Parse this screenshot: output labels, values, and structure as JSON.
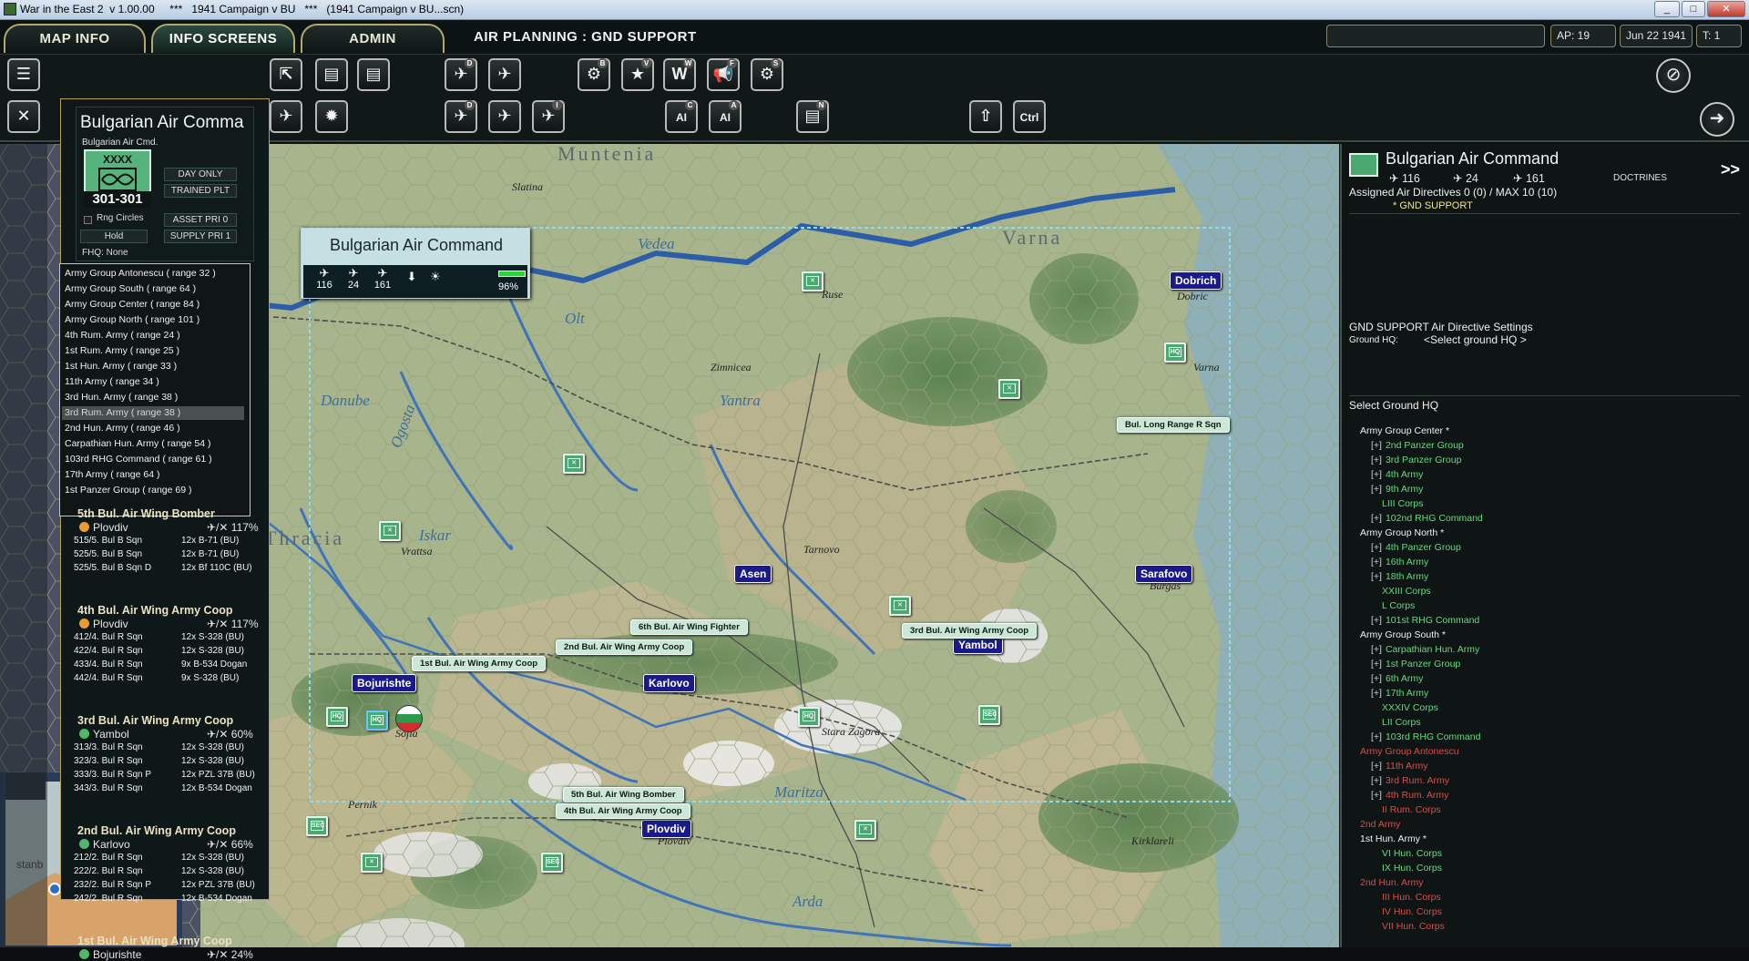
{
  "window": {
    "title": "War in the East 2  v 1.00.00     ***   1941 Campaign v BU   ***   (1941 Campaign v BU...scn)",
    "minimize": "_",
    "maximize": "□",
    "close": "✕"
  },
  "menu": {
    "tabs": [
      "MAP INFO",
      "INFO SCREENS",
      "ADMIN"
    ],
    "active": "INFO SCREENS",
    "screen_title": "AIR PLANNING : GND SUPPORT"
  },
  "status": {
    "ap": "AP: 19",
    "date": "Jun 22 1941",
    "turn": "T: 1"
  },
  "toolbar": {
    "row1": [
      {
        "icon": "unit-reaction-icon",
        "glyph": "⇱",
        "key": ""
      },
      {
        "icon": "orders-icon",
        "glyph": "▤",
        "key": ""
      },
      {
        "icon": "orders2-icon",
        "glyph": "▤",
        "key": ""
      },
      {
        "icon": "air-transfer-icon",
        "glyph": "✈",
        "key": "D"
      },
      {
        "icon": "air-move-icon",
        "glyph": "✈",
        "key": ""
      },
      {
        "icon": "theater-icon",
        "glyph": "⚙",
        "key": "B"
      },
      {
        "icon": "star-icon",
        "glyph": "★",
        "key": "V"
      },
      {
        "icon": "weather-icon",
        "glyph": "W",
        "key": "W"
      },
      {
        "icon": "announce-icon",
        "glyph": "📢",
        "key": "F"
      },
      {
        "icon": "settings-icon",
        "glyph": "⚙",
        "key": "S"
      }
    ],
    "row2": [
      {
        "icon": "air-mission-icon",
        "glyph": "✈",
        "key": "D"
      },
      {
        "icon": "air-mission2-icon",
        "glyph": "✈",
        "key": ""
      },
      {
        "icon": "air-strike-icon",
        "glyph": "✈",
        "key": "I"
      },
      {
        "icon": "ai-map-icon",
        "glyph": "AI",
        "key": "C"
      },
      {
        "icon": "ai-air-icon",
        "glyph": "AI",
        "key": "A"
      },
      {
        "icon": "air-list-icon",
        "glyph": "▤",
        "key": "N"
      },
      {
        "icon": "shift-icon",
        "glyph": "⇧",
        "key": ""
      },
      {
        "icon": "ctrl-icon",
        "glyph": "Ctrl",
        "key": ""
      }
    ]
  },
  "left_panel": {
    "hq": {
      "title": "Bulgarian Air Comma",
      "subtitle": "Bulgarian Air Cmd.",
      "echelon": "XXXX",
      "id": "301-301",
      "day_only": "DAY ONLY",
      "trained": "TRAINED PLT",
      "rng_circles": "Rng Circles",
      "asset_pri": "ASSET PRI 0",
      "hold": "Hold",
      "supply_pri": "SUPPLY PRI 1",
      "fhq": "FHQ: None"
    },
    "ground_list": [
      "Army Group Antonescu ( range 32 )",
      "Army Group South ( range 64 )",
      "Army Group Center ( range 84 )",
      "Army Group North ( range 101 )",
      "4th Rum. Army ( range 24 )",
      "1st Rum. Army ( range 25 )",
      "1st Hun. Army ( range 33 )",
      "11th Army ( range 34 )",
      "3rd Hun. Army ( range 38 )",
      "3rd Rum. Army ( range 38 )",
      "2nd Hun. Army ( range 46 )",
      "Carpathian Hun. Army ( range 54 )",
      "103rd RHG Command ( range 61 )",
      "17th Army ( range 64 )",
      "1st Panzer Group ( range 69 )"
    ],
    "ground_list_selected": 9,
    "wings": [
      {
        "title": "5th Bul. Air Wing Bomber",
        "base": "Plovdiv",
        "pct": "117%",
        "dot": "orange",
        "squadrons": [
          [
            "515/5. Bul B Sqn",
            "12x B-71 (BU)"
          ],
          [
            "525/5. Bul B Sqn",
            "12x B-71 (BU)"
          ],
          [
            "525/5. Bul B Sqn D",
            "12x Bf 110C (BU)"
          ]
        ]
      },
      {
        "title": "4th Bul. Air Wing Army Coop",
        "base": "Plovdiv",
        "pct": "117%",
        "dot": "orange",
        "squadrons": [
          [
            "412/4. Bul R Sqn",
            "12x S-328 (BU)"
          ],
          [
            "422/4. Bul R Sqn",
            "12x S-328 (BU)"
          ],
          [
            "433/4. Bul R Sqn",
            "9x B-534 Dogan"
          ],
          [
            "442/4. Bul R Sqn",
            "9x S-328 (BU)"
          ]
        ]
      },
      {
        "title": "3rd Bul. Air Wing Army Coop",
        "base": "Yambol",
        "pct": "60%",
        "dot": "green",
        "squadrons": [
          [
            "313/3. Bul R Sqn",
            "12x S-328 (BU)"
          ],
          [
            "323/3. Bul R Sqn",
            "12x S-328 (BU)"
          ],
          [
            "333/3. Bul R Sqn P",
            "12x PZL 37B (BU)"
          ],
          [
            "343/3. Bul R Sqn",
            "12x B-534 Dogan"
          ]
        ]
      },
      {
        "title": "2nd Bul. Air Wing Army Coop",
        "base": "Karlovo",
        "pct": "66%",
        "dot": "green",
        "squadrons": [
          [
            "212/2. Bul R Sqn",
            "12x S-328 (BU)"
          ],
          [
            "222/2. Bul R Sqn",
            "12x S-328 (BU)"
          ],
          [
            "232/2. Bul R Sqn P",
            "12x PZL 37B (BU)"
          ],
          [
            "242/2. Bul R Sqn",
            "12x B-534 Dogan"
          ]
        ]
      },
      {
        "title": "1st Bul. Air Wing Army Coop",
        "base": "Bojurishte",
        "pct": "24%",
        "dot": "green",
        "squadrons": []
      }
    ]
  },
  "map": {
    "airbox": {
      "name": "Bulgarian Air Command",
      "fighters": "116",
      "bombers": "24",
      "recon": "161",
      "morale": "96%"
    },
    "regions": [
      "Muntenia",
      "Varna",
      "Thracia"
    ],
    "rivers": [
      "Vedea",
      "Olt",
      "Danube",
      "Ogosta",
      "Iskar",
      "Yantra",
      "Maritza",
      "Arda"
    ],
    "towns": [
      "Slatina",
      "Ruse",
      "Zimnicea",
      "Dobric",
      "Varna",
      "Vrattsa",
      "Tarnovo",
      "Burgas",
      "Stara Zagora",
      "Pernik",
      "Plovdiv",
      "Kirklareli",
      "Sofia"
    ],
    "cities": [
      "Dobrich",
      "Asen",
      "Sarafovo",
      "Yambol",
      "Bojurishte",
      "Karlovo",
      "Plovdiv"
    ],
    "air_units": [
      "Bul. Long Range R Sqn",
      "6th Bul. Air Wing Fighter",
      "2nd Bul. Air Wing Army Coop",
      "1st Bul. Air Wing Army Coop",
      "3rd Bul. Air Wing Army Coop",
      "5th Bul. Air Wing Bomber",
      "4th Bul. Air Wing Army Coop"
    ],
    "minimap_label": "stanb"
  },
  "right_panel": {
    "title": "Bulgarian Air Command",
    "fighters": "116",
    "bombers": "24",
    "recon": "161",
    "doctrines": "DOCTRINES",
    "more": ">>",
    "assigned": "Assigned Air Directives 0 (0) / MAX 10 (10)",
    "directive": "* GND SUPPORT",
    "settings_title": "GND SUPPORT Air Directive Settings",
    "ground_hq_label": "Ground HQ:",
    "ground_hq_value": "<Select ground HQ >",
    "select_title": "Select Ground HQ",
    "tree": [
      {
        "indent": 0,
        "pm": "",
        "text": "Army Group Center *",
        "color": "w"
      },
      {
        "indent": 1,
        "pm": "[+]",
        "text": "2nd Panzer Group",
        "color": "g"
      },
      {
        "indent": 1,
        "pm": "[+]",
        "text": "3rd Panzer Group",
        "color": "g"
      },
      {
        "indent": 1,
        "pm": "[+]",
        "text": "4th Army",
        "color": "g"
      },
      {
        "indent": 1,
        "pm": "[+]",
        "text": "9th Army",
        "color": "g"
      },
      {
        "indent": 2,
        "pm": "",
        "text": "LIII Corps",
        "color": "g"
      },
      {
        "indent": 1,
        "pm": "[+]",
        "text": "102nd RHG Command",
        "color": "g"
      },
      {
        "indent": 0,
        "pm": "",
        "text": "Army Group North *",
        "color": "w"
      },
      {
        "indent": 1,
        "pm": "[+]",
        "text": "4th Panzer Group",
        "color": "g"
      },
      {
        "indent": 1,
        "pm": "[+]",
        "text": "16th Army",
        "color": "g"
      },
      {
        "indent": 1,
        "pm": "[+]",
        "text": "18th Army",
        "color": "g"
      },
      {
        "indent": 2,
        "pm": "",
        "text": "XXIII Corps",
        "color": "g"
      },
      {
        "indent": 2,
        "pm": "",
        "text": "L Corps",
        "color": "g"
      },
      {
        "indent": 1,
        "pm": "[+]",
        "text": "101st RHG Command",
        "color": "g"
      },
      {
        "indent": 0,
        "pm": "",
        "text": "Army Group South *",
        "color": "w"
      },
      {
        "indent": 1,
        "pm": "[+]",
        "text": "Carpathian Hun. Army",
        "color": "g"
      },
      {
        "indent": 1,
        "pm": "[+]",
        "text": "1st Panzer Group",
        "color": "g"
      },
      {
        "indent": 1,
        "pm": "[+]",
        "text": "6th Army",
        "color": "g"
      },
      {
        "indent": 1,
        "pm": "[+]",
        "text": "17th Army",
        "color": "g"
      },
      {
        "indent": 2,
        "pm": "",
        "text": "XXXIV Corps",
        "color": "g"
      },
      {
        "indent": 2,
        "pm": "",
        "text": "LII Corps",
        "color": "g"
      },
      {
        "indent": 1,
        "pm": "[+]",
        "text": "103rd RHG Command",
        "color": "g"
      },
      {
        "indent": 0,
        "pm": "",
        "text": "Army Group Antonescu",
        "color": "r"
      },
      {
        "indent": 1,
        "pm": "[+]",
        "text": "11th Army",
        "color": "r"
      },
      {
        "indent": 1,
        "pm": "[+]",
        "text": "3rd Rum. Army",
        "color": "r"
      },
      {
        "indent": 1,
        "pm": "[+]",
        "text": "4th Rum. Army",
        "color": "r"
      },
      {
        "indent": 2,
        "pm": "",
        "text": "II Rum. Corps",
        "color": "r"
      },
      {
        "indent": 0,
        "pm": "",
        "text": "2nd Army",
        "color": "r"
      },
      {
        "indent": 0,
        "pm": "",
        "text": "1st Hun. Army *",
        "color": "w"
      },
      {
        "indent": 2,
        "pm": "",
        "text": "VI Hun. Corps",
        "color": "g"
      },
      {
        "indent": 2,
        "pm": "",
        "text": "IX Hun. Corps",
        "color": "g"
      },
      {
        "indent": 0,
        "pm": "",
        "text": "2nd Hun. Army",
        "color": "r"
      },
      {
        "indent": 2,
        "pm": "",
        "text": "III Hun. Corps",
        "color": "r"
      },
      {
        "indent": 2,
        "pm": "",
        "text": "IV Hun. Corps",
        "color": "r"
      },
      {
        "indent": 2,
        "pm": "",
        "text": "VII Hun. Corps",
        "color": "r"
      }
    ]
  }
}
